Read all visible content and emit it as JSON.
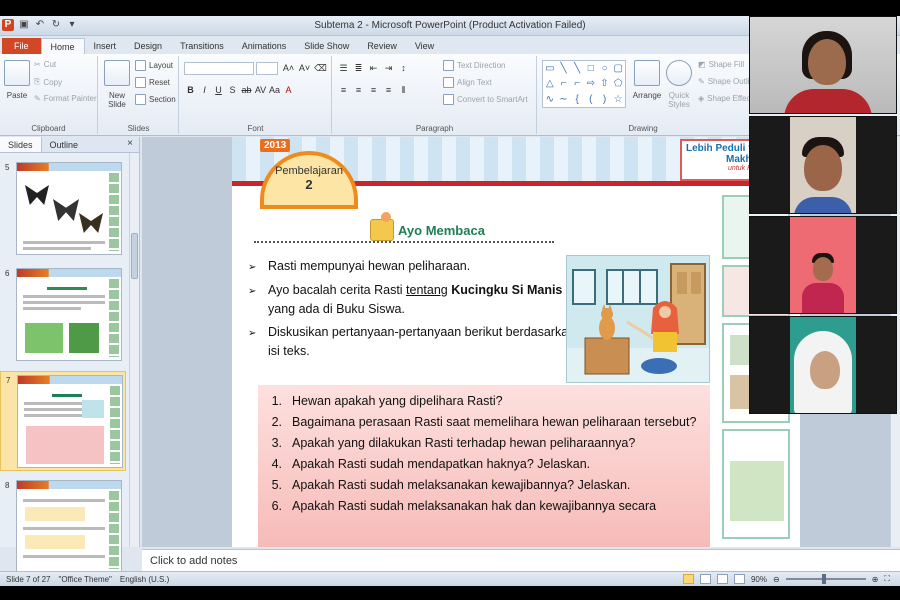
{
  "app": {
    "window_title": "Subtema 2 - Microsoft PowerPoint (Product Activation Failed)"
  },
  "ribbon_tabs": [
    {
      "label": "File"
    },
    {
      "label": "Home"
    },
    {
      "label": "Insert"
    },
    {
      "label": "Design"
    },
    {
      "label": "Transitions"
    },
    {
      "label": "Animations"
    },
    {
      "label": "Slide Show"
    },
    {
      "label": "Review"
    },
    {
      "label": "View"
    }
  ],
  "ribbon": {
    "clipboard": {
      "paste": "Paste",
      "cut": "Cut",
      "copy": "Copy",
      "format_painter": "Format Painter",
      "label": "Clipboard"
    },
    "slides": {
      "new_slide": "New Slide",
      "layout": "Layout",
      "reset": "Reset",
      "section": "Section",
      "label": "Slides"
    },
    "font": {
      "label": "Font"
    },
    "paragraph": {
      "text_direction": "Text Direction",
      "align_text": "Align Text",
      "convert_smartart": "Convert to SmartArt",
      "label": "Paragraph"
    },
    "drawing": {
      "arrange": "Arrange",
      "quick_styles": "Quick Styles",
      "shape_fill": "Shape Fill",
      "shape_outline": "Shape Outline",
      "shape_effects": "Shape Effects",
      "label": "Drawing"
    }
  },
  "slides_pane": {
    "tabs": [
      "Slides",
      "Outline"
    ],
    "thumbnails": [
      {
        "number": "5"
      },
      {
        "number": "6"
      },
      {
        "number": "7"
      },
      {
        "number": "8"
      }
    ]
  },
  "slide": {
    "badge": "2013",
    "pembelajaran": "Pembelajaran",
    "pembelajaran_num": "2",
    "corner_line1": "Lebih Peduli t",
    "corner_line2": "Makhluk H",
    "corner_line3": "untuk Kelas 5",
    "section_title": "Ayo Membaca",
    "bullet1": "Rasti mempunyai hewan peliharaan.",
    "bullet2_a": "Ayo bacalah cerita Rasti ",
    "bullet2_u": "tentang",
    "bullet2_b": "Kucingku Si Manis",
    "bullet2_c": "yang ada di Buku Siswa.",
    "bullet3": "Diskusikan pertanyaan-pertanyaan berikut berdasarkan isi teks.",
    "questions": [
      {
        "n": "1.",
        "text": "Hewan apakah yang dipelihara Rasti?"
      },
      {
        "n": "2.",
        "text": "Bagaimana perasaan Rasti saat memelihara hewan peliharaan tersebut?"
      },
      {
        "n": "3.",
        "text": "Apakah yang dilakukan Rasti terhadap hewan peliharaannya?"
      },
      {
        "n": "4.",
        "text": "Apakah Rasti sudah mendapatkan haknya? Jelaskan."
      },
      {
        "n": "5.",
        "text": "Apakah Rasti sudah melaksanakan kewajibannya? Jelaskan."
      },
      {
        "n": "6.",
        "text": "Apakah Rasti sudah melaksanakan hak dan kewajibannya secara"
      }
    ]
  },
  "notes": {
    "placeholder": "Click to add notes"
  },
  "status": {
    "slide": "Slide 7 of 27",
    "theme": "\"Office Theme\"",
    "language": "English (U.S.)",
    "zoom": "90%"
  },
  "colors": {
    "file_tab": "#d24726",
    "section_green": "#1e7f54",
    "question_box": "#f6b9b6"
  }
}
